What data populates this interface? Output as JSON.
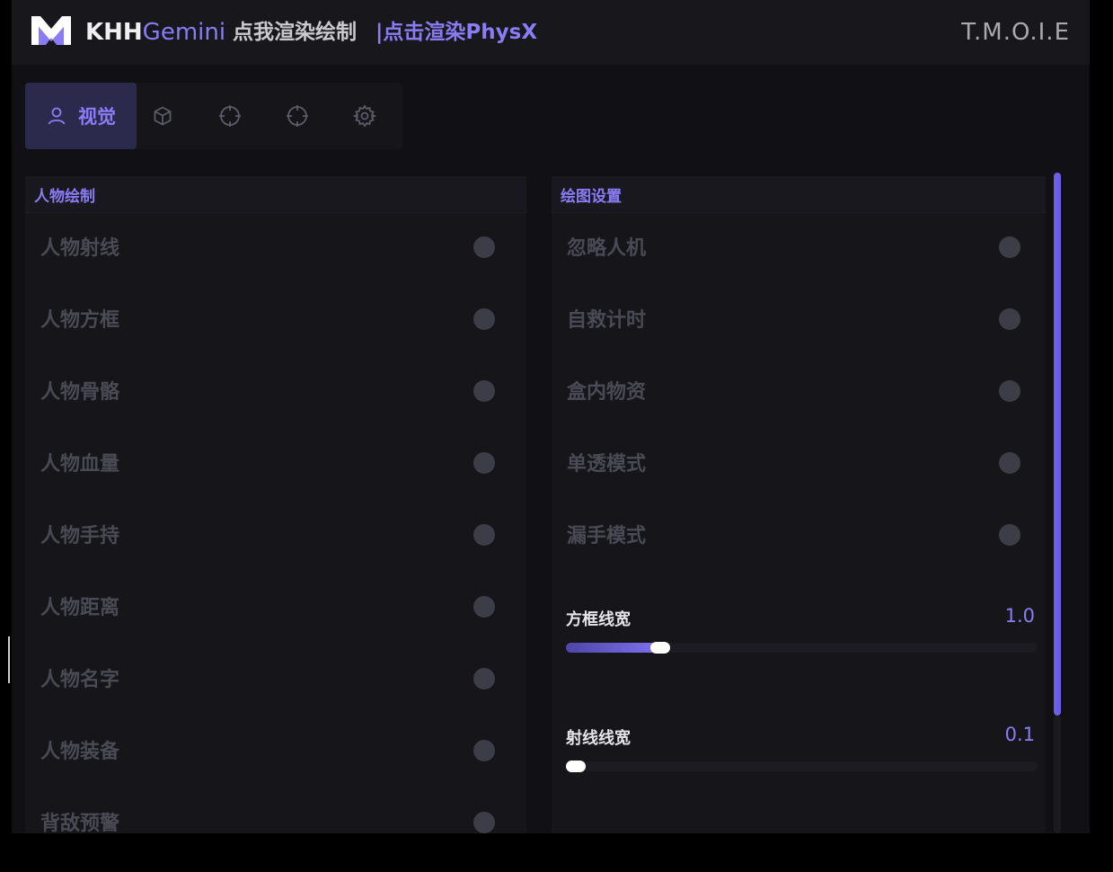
{
  "header": {
    "brand_white": "KHH",
    "brand_purple": "Gemini",
    "render_label": "点我渲染绘制",
    "physx_label": "|点击渲染PhysX",
    "right_title": "T.M.O.I.E"
  },
  "tabs": [
    {
      "label": "视觉",
      "icon": "user-icon",
      "active": true
    },
    {
      "icon": "box-icon"
    },
    {
      "icon": "crosshair-icon"
    },
    {
      "icon": "crosshair-icon"
    },
    {
      "icon": "gear-icon"
    }
  ],
  "left_panel": {
    "title": "人物绘制",
    "items": [
      {
        "label": "人物射线",
        "on": false
      },
      {
        "label": "人物方框",
        "on": false
      },
      {
        "label": "人物骨骼",
        "on": false
      },
      {
        "label": "人物血量",
        "on": false
      },
      {
        "label": "人物手持",
        "on": false
      },
      {
        "label": "人物距离",
        "on": false
      },
      {
        "label": "人物名字",
        "on": false
      },
      {
        "label": "人物装备",
        "on": false
      },
      {
        "label": "背敌预警",
        "on": false
      }
    ]
  },
  "right_panel": {
    "title": "绘图设置",
    "items": [
      {
        "label": "忽略人机",
        "on": false
      },
      {
        "label": "自救计时",
        "on": false
      },
      {
        "label": "盒内物资",
        "on": false
      },
      {
        "label": "单透模式",
        "on": false
      },
      {
        "label": "漏手模式",
        "on": false
      }
    ],
    "sliders": [
      {
        "label": "方框线宽",
        "value": "1.0",
        "fraction": 0.2
      },
      {
        "label": "射线线宽",
        "value": "0.1",
        "fraction": 0.02
      }
    ]
  },
  "colors": {
    "accent": "#8a7cf5",
    "background": "#111115",
    "panel": "#15151a"
  }
}
